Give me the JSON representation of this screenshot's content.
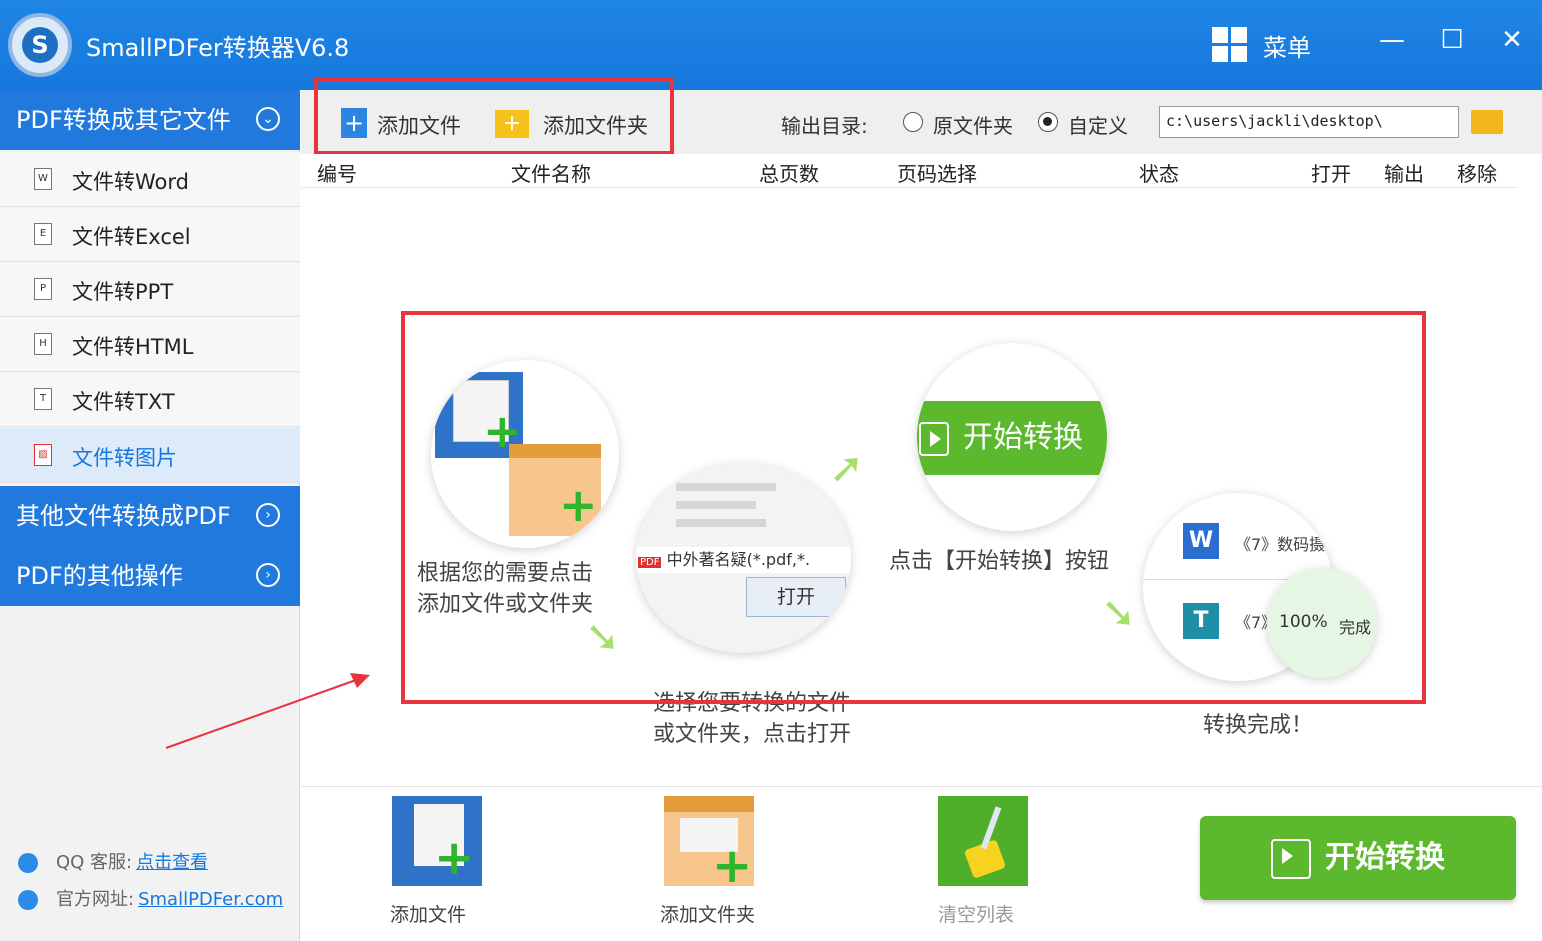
{
  "window": {
    "title": "SmallPDFer转换器V6.8",
    "menu_label": "菜单",
    "minimize": "—",
    "maximize": "☐",
    "close": "✕"
  },
  "sidebar": {
    "section1": "PDF转换成其它文件",
    "items": [
      {
        "label": "文件转Word",
        "icon": "W"
      },
      {
        "label": "文件转Excel",
        "icon": "E"
      },
      {
        "label": "文件转PPT",
        "icon": "P"
      },
      {
        "label": "文件转HTML",
        "icon": "H"
      },
      {
        "label": "文件转TXT",
        "icon": "T"
      },
      {
        "label": "文件转图片",
        "icon": "▨"
      }
    ],
    "section2": "其他文件转换成PDF",
    "section3": "PDF的其他操作",
    "qq_label": "QQ 客服:",
    "qq_link": "点击查看",
    "site_label": "官方网址:",
    "site_link": "SmallPDFer.com"
  },
  "toolbar": {
    "add_file": "添加文件",
    "add_folder": "添加文件夹",
    "output_label": "输出目录:",
    "option_original": "原文件夹",
    "option_custom": "自定义",
    "selected_option": "自定义",
    "output_path": "c:\\users\\jackli\\desktop\\"
  },
  "table": {
    "columns": [
      "编号",
      "文件名称",
      "总页数",
      "页码选择",
      "状态",
      "打开",
      "输出",
      "移除"
    ]
  },
  "guide": {
    "step1": [
      "根据您的需要点击",
      "添加文件或文件夹"
    ],
    "step2": [
      "选择您要转换的文件",
      "或文件夹，点击打开"
    ],
    "step2_file": "中外著名疑",
    "step2_filter": "(*.pdf,*.",
    "step2_open": "打开",
    "step3_button": "开始转换",
    "step3": "点击【开始转换】按钮",
    "step4_row1": "《7》数码摄",
    "step4_row2": "《7》",
    "step4_progress": "100%",
    "step4_status": "完成",
    "step4": "转换完成！"
  },
  "bottom": {
    "add_file": "添加文件",
    "add_folder": "添加文件夹",
    "clear_list": "清空列表",
    "start": "开始转换"
  },
  "colors": {
    "titlebar": "#1f86e6",
    "sidebar_header": "#2179dd",
    "start_green": "#5cb82c",
    "highlight_red": "#e7343f"
  }
}
